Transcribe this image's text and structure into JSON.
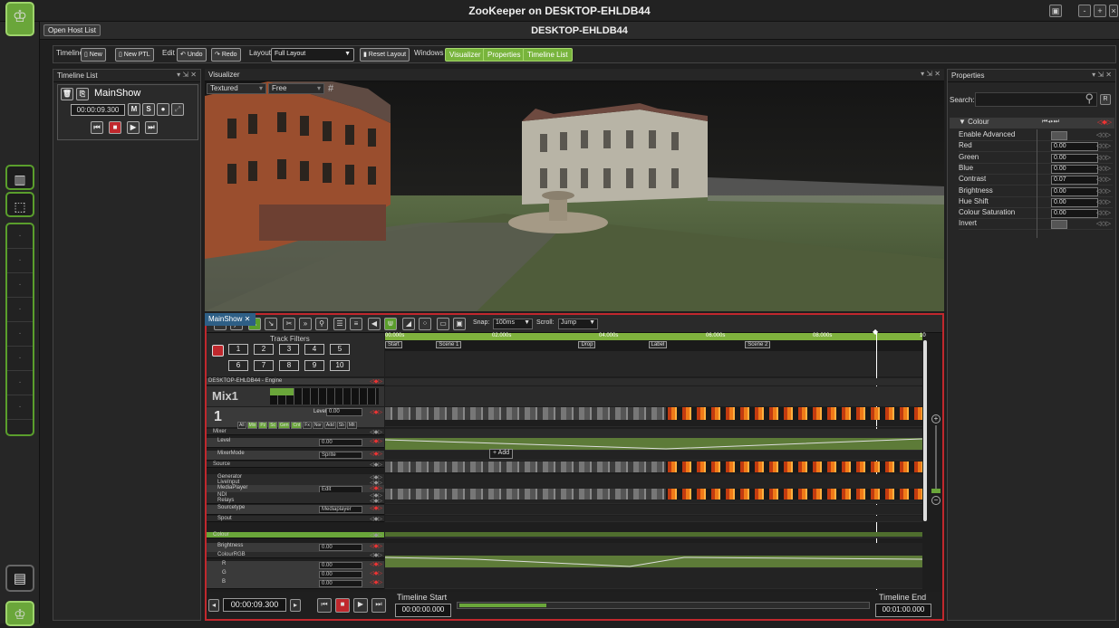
{
  "window": {
    "title": "ZooKeeper on DESKTOP-EHLDB44",
    "host": "DESKTOP-EHLDB44",
    "open_host_list": "Open Host List"
  },
  "toolbar": {
    "timeline_label": "Timeline",
    "new": "New",
    "new_ptl": "New PTL",
    "edit_label": "Edit",
    "undo": "Undo",
    "redo": "Redo",
    "layout_label": "Layout",
    "layout_value": "Full Layout",
    "reset_layout": "Reset Layout",
    "windows_label": "Windows",
    "visualizer": "Visualizer",
    "properties": "Properties",
    "timeline_list": "Timeline List"
  },
  "timeline_list": {
    "title": "Timeline List",
    "show_name": "MainShow",
    "time": "00:00:09.300",
    "m": "M",
    "s": "S"
  },
  "visualizer": {
    "title": "Visualizer",
    "render_mode": "Textured",
    "camera_mode": "Free"
  },
  "properties": {
    "title": "Properties",
    "search_label": "Search:",
    "reset": "R",
    "group": "Colour",
    "rows": [
      {
        "label": "Enable Advanced",
        "value": ""
      },
      {
        "label": "Red",
        "value": "0.00"
      },
      {
        "label": "Green",
        "value": "0.00"
      },
      {
        "label": "Blue",
        "value": "0.00"
      },
      {
        "label": "Contrast",
        "value": "0.07"
      },
      {
        "label": "Brightness",
        "value": "0.00"
      },
      {
        "label": "Hue Shift",
        "value": "0.00"
      },
      {
        "label": "Colour Saturation",
        "value": "0.00"
      },
      {
        "label": "Invert",
        "value": ""
      }
    ]
  },
  "mainshow": {
    "tab": "MainShow",
    "snap_label": "Snap:",
    "snap_value": "100ms",
    "scroll_label": "Scroll:",
    "scroll_value": "Jump",
    "track_filters": "Track Filters",
    "filters_row1": [
      "1",
      "2",
      "3",
      "4",
      "5"
    ],
    "filters_row2": [
      "6",
      "7",
      "8",
      "9",
      "10"
    ],
    "ruler": [
      "00.000s",
      "02.000s",
      "04.000s",
      "06.000s",
      "08.000s",
      "10"
    ],
    "cues": [
      {
        "label": "Start",
        "pos": 0
      },
      {
        "label": "Scene 1",
        "pos": 9.5
      },
      {
        "label": "Drop",
        "pos": 36
      },
      {
        "label": "Label",
        "pos": 49
      },
      {
        "label": "Scene 2",
        "pos": 67
      }
    ],
    "engine_row": "DESKTOP-EHLDB44 - Engine",
    "mix": "Mix1",
    "layer": "1",
    "level_label": "Level",
    "level_value": "0.00",
    "blend_tabs": [
      "All",
      "Mix",
      "Pz",
      "Sc",
      "Gen",
      "Cnt",
      "Fx",
      "Nor",
      "Add",
      "Sb",
      "Mlt"
    ],
    "rows": [
      {
        "label": "Mixer",
        "indent": 1
      },
      {
        "label": "Level",
        "value": "0.00",
        "indent": 2
      },
      {
        "label": "MixerMode",
        "value": "Sprite",
        "indent": 2
      },
      {
        "label": "Source",
        "indent": 1
      },
      {
        "label": "Generator",
        "indent": 2
      },
      {
        "label": "LiveInput",
        "indent": 2
      },
      {
        "label": "MediaPlayer",
        "value": "Edit",
        "indent": 2
      },
      {
        "label": "NDI",
        "indent": 2
      },
      {
        "label": "Relays",
        "indent": 2
      },
      {
        "label": "Sourcetype",
        "value": "Mediaplayer",
        "indent": 2
      },
      {
        "label": "Spout",
        "indent": 2
      },
      {
        "label": "Colour",
        "indent": 1
      },
      {
        "label": "Brightness",
        "value": "0.00",
        "indent": 2
      },
      {
        "label": "ColourRGB",
        "indent": 2
      },
      {
        "label": "R",
        "value": "0.00",
        "indent": 3
      },
      {
        "label": "G",
        "value": "0.00",
        "indent": 3
      },
      {
        "label": "B",
        "value": "0.00",
        "indent": 3
      }
    ],
    "add_label": "Add",
    "footer": {
      "time": "00:00:09.300",
      "start_label": "Timeline Start",
      "start_value": "00:00:00.000",
      "end_label": "Timeline End",
      "end_value": "00:01:00.000"
    }
  },
  "colors": {
    "accent_green": "#78b43c",
    "record_red": "#c0282d",
    "tab_blue": "#2e5f86"
  }
}
